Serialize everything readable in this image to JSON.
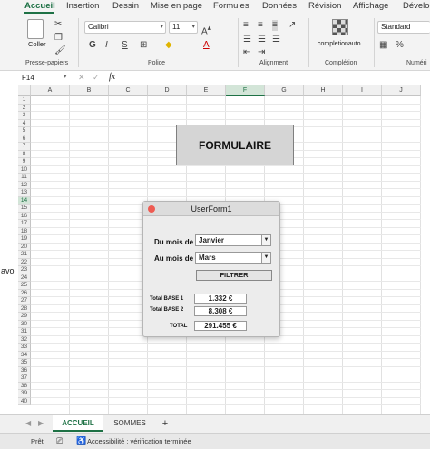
{
  "ribbon_tabs": [
    "Accueil",
    "Insertion",
    "Dessin",
    "Mise en page",
    "Formules",
    "Données",
    "Révision",
    "Affichage",
    "Dévelo"
  ],
  "clipboard": {
    "paste_label": "Coller",
    "group_label": "Presse-papiers"
  },
  "font": {
    "name": "Calibri",
    "size": "11",
    "bold": "G",
    "italic": "I",
    "underline": "S",
    "group_label": "Police"
  },
  "alignment": {
    "group_label": "Alignment"
  },
  "completion": {
    "label": "completionauto",
    "group_label": "Complétion"
  },
  "number": {
    "format": "Standard",
    "group_label": "Numéri"
  },
  "formula_bar": {
    "cell_ref": "F14",
    "cancel": "✕",
    "confirm": "✓",
    "fx": "fx"
  },
  "columns": [
    "A",
    "B",
    "C",
    "D",
    "E",
    "F",
    "G",
    "H",
    "I",
    "J"
  ],
  "rows": [
    "1",
    "2",
    "3",
    "4",
    "5",
    "6",
    "7",
    "8",
    "9",
    "10",
    "11",
    "12",
    "13",
    "14",
    "15",
    "16",
    "17",
    "18",
    "19",
    "20",
    "21",
    "22",
    "23",
    "24",
    "25",
    "26",
    "27",
    "28",
    "29",
    "30",
    "31",
    "32",
    "33",
    "34",
    "35",
    "36",
    "37",
    "38",
    "39",
    "40"
  ],
  "selected_column": "F",
  "selected_row": "14",
  "shape": {
    "label": "FORMULAIRE"
  },
  "userform": {
    "title": "UserForm1",
    "from_label": "Du mois de",
    "from_value": "Janvier",
    "to_label": "Au mois de",
    "to_value": "Mars",
    "filter_button": "FILTRER",
    "total_base1_label": "Total BASE 1",
    "total_base1_value": "1.332 €",
    "total_base2_label": "Total BASE 2",
    "total_base2_value": "8.308 €",
    "total_label": "TOTAL",
    "total_value": "291.455 €"
  },
  "edge_fragment": "avo",
  "sheets": {
    "active": "ACCUEIL",
    "other": "SOMMES",
    "add": "+"
  },
  "status": {
    "ready": "Prêt",
    "accessibility": "Accessibilité : vérification terminée"
  }
}
